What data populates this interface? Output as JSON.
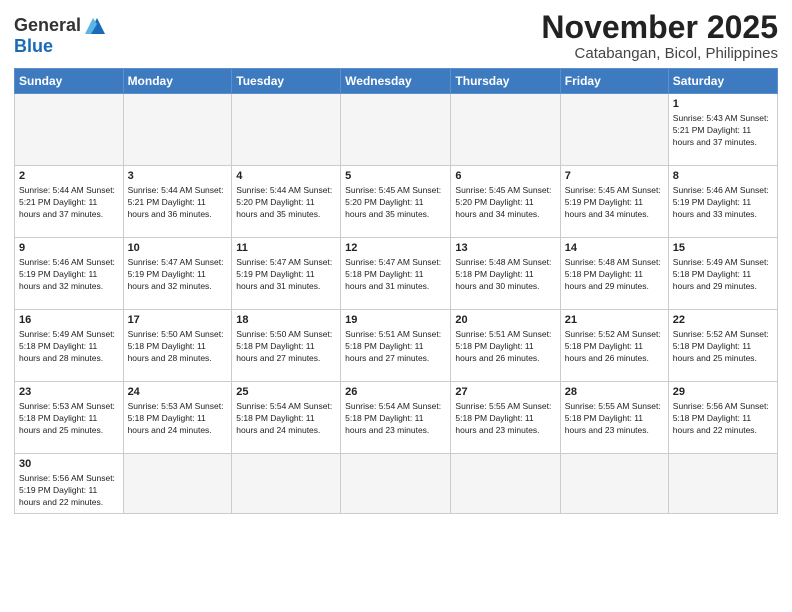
{
  "logo": {
    "general": "General",
    "blue": "Blue"
  },
  "title": {
    "month_year": "November 2025",
    "location": "Catabangan, Bicol, Philippines"
  },
  "weekdays": [
    "Sunday",
    "Monday",
    "Tuesday",
    "Wednesday",
    "Thursday",
    "Friday",
    "Saturday"
  ],
  "weeks": [
    [
      {
        "day": "",
        "info": ""
      },
      {
        "day": "",
        "info": ""
      },
      {
        "day": "",
        "info": ""
      },
      {
        "day": "",
        "info": ""
      },
      {
        "day": "",
        "info": ""
      },
      {
        "day": "",
        "info": ""
      },
      {
        "day": "1",
        "info": "Sunrise: 5:43 AM\nSunset: 5:21 PM\nDaylight: 11 hours\nand 37 minutes."
      }
    ],
    [
      {
        "day": "2",
        "info": "Sunrise: 5:44 AM\nSunset: 5:21 PM\nDaylight: 11 hours\nand 37 minutes."
      },
      {
        "day": "3",
        "info": "Sunrise: 5:44 AM\nSunset: 5:21 PM\nDaylight: 11 hours\nand 36 minutes."
      },
      {
        "day": "4",
        "info": "Sunrise: 5:44 AM\nSunset: 5:20 PM\nDaylight: 11 hours\nand 35 minutes."
      },
      {
        "day": "5",
        "info": "Sunrise: 5:45 AM\nSunset: 5:20 PM\nDaylight: 11 hours\nand 35 minutes."
      },
      {
        "day": "6",
        "info": "Sunrise: 5:45 AM\nSunset: 5:20 PM\nDaylight: 11 hours\nand 34 minutes."
      },
      {
        "day": "7",
        "info": "Sunrise: 5:45 AM\nSunset: 5:19 PM\nDaylight: 11 hours\nand 34 minutes."
      },
      {
        "day": "8",
        "info": "Sunrise: 5:46 AM\nSunset: 5:19 PM\nDaylight: 11 hours\nand 33 minutes."
      }
    ],
    [
      {
        "day": "9",
        "info": "Sunrise: 5:46 AM\nSunset: 5:19 PM\nDaylight: 11 hours\nand 32 minutes."
      },
      {
        "day": "10",
        "info": "Sunrise: 5:47 AM\nSunset: 5:19 PM\nDaylight: 11 hours\nand 32 minutes."
      },
      {
        "day": "11",
        "info": "Sunrise: 5:47 AM\nSunset: 5:19 PM\nDaylight: 11 hours\nand 31 minutes."
      },
      {
        "day": "12",
        "info": "Sunrise: 5:47 AM\nSunset: 5:18 PM\nDaylight: 11 hours\nand 31 minutes."
      },
      {
        "day": "13",
        "info": "Sunrise: 5:48 AM\nSunset: 5:18 PM\nDaylight: 11 hours\nand 30 minutes."
      },
      {
        "day": "14",
        "info": "Sunrise: 5:48 AM\nSunset: 5:18 PM\nDaylight: 11 hours\nand 29 minutes."
      },
      {
        "day": "15",
        "info": "Sunrise: 5:49 AM\nSunset: 5:18 PM\nDaylight: 11 hours\nand 29 minutes."
      }
    ],
    [
      {
        "day": "16",
        "info": "Sunrise: 5:49 AM\nSunset: 5:18 PM\nDaylight: 11 hours\nand 28 minutes."
      },
      {
        "day": "17",
        "info": "Sunrise: 5:50 AM\nSunset: 5:18 PM\nDaylight: 11 hours\nand 28 minutes."
      },
      {
        "day": "18",
        "info": "Sunrise: 5:50 AM\nSunset: 5:18 PM\nDaylight: 11 hours\nand 27 minutes."
      },
      {
        "day": "19",
        "info": "Sunrise: 5:51 AM\nSunset: 5:18 PM\nDaylight: 11 hours\nand 27 minutes."
      },
      {
        "day": "20",
        "info": "Sunrise: 5:51 AM\nSunset: 5:18 PM\nDaylight: 11 hours\nand 26 minutes."
      },
      {
        "day": "21",
        "info": "Sunrise: 5:52 AM\nSunset: 5:18 PM\nDaylight: 11 hours\nand 26 minutes."
      },
      {
        "day": "22",
        "info": "Sunrise: 5:52 AM\nSunset: 5:18 PM\nDaylight: 11 hours\nand 25 minutes."
      }
    ],
    [
      {
        "day": "23",
        "info": "Sunrise: 5:53 AM\nSunset: 5:18 PM\nDaylight: 11 hours\nand 25 minutes."
      },
      {
        "day": "24",
        "info": "Sunrise: 5:53 AM\nSunset: 5:18 PM\nDaylight: 11 hours\nand 24 minutes."
      },
      {
        "day": "25",
        "info": "Sunrise: 5:54 AM\nSunset: 5:18 PM\nDaylight: 11 hours\nand 24 minutes."
      },
      {
        "day": "26",
        "info": "Sunrise: 5:54 AM\nSunset: 5:18 PM\nDaylight: 11 hours\nand 23 minutes."
      },
      {
        "day": "27",
        "info": "Sunrise: 5:55 AM\nSunset: 5:18 PM\nDaylight: 11 hours\nand 23 minutes."
      },
      {
        "day": "28",
        "info": "Sunrise: 5:55 AM\nSunset: 5:18 PM\nDaylight: 11 hours\nand 23 minutes."
      },
      {
        "day": "29",
        "info": "Sunrise: 5:56 AM\nSunset: 5:18 PM\nDaylight: 11 hours\nand 22 minutes."
      }
    ],
    [
      {
        "day": "30",
        "info": "Sunrise: 5:56 AM\nSunset: 5:19 PM\nDaylight: 11 hours\nand 22 minutes."
      },
      {
        "day": "",
        "info": ""
      },
      {
        "day": "",
        "info": ""
      },
      {
        "day": "",
        "info": ""
      },
      {
        "day": "",
        "info": ""
      },
      {
        "day": "",
        "info": ""
      },
      {
        "day": "",
        "info": ""
      }
    ]
  ]
}
